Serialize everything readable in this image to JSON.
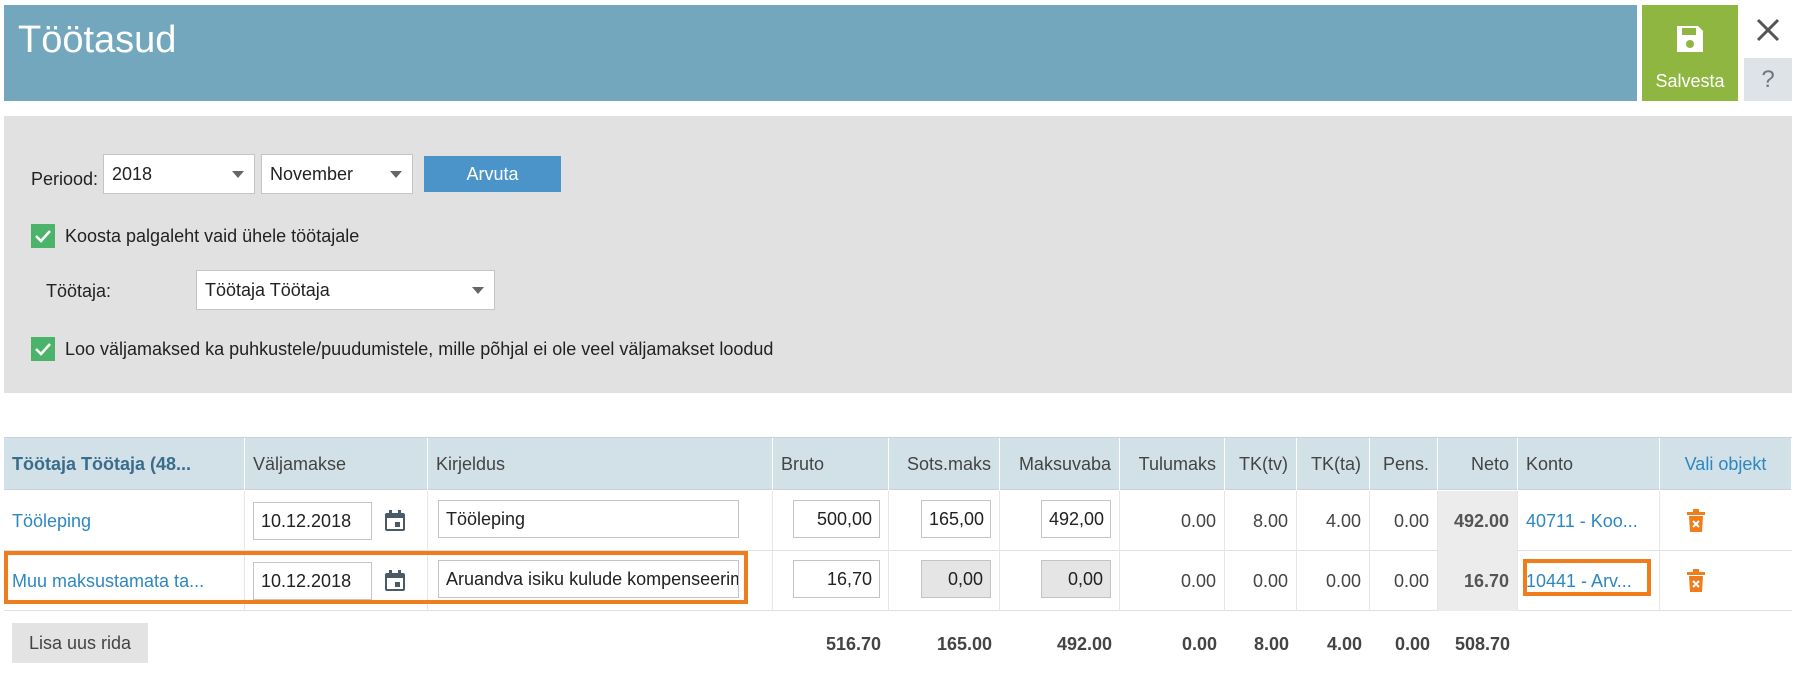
{
  "header": {
    "title": "Töötasud",
    "save_label": "Salvesta",
    "help_label": "?"
  },
  "filters": {
    "period_label": "Periood:",
    "year": "2018",
    "month": "November",
    "compute_label": "Arvuta",
    "single_employee_label": "Koosta palgaleht vaid ühele töötajale",
    "single_employee_checked": true,
    "employee_label": "Töötaja:",
    "employee_value": "Töötaja Töötaja",
    "absences_label": "Loo väljamaksed ka puhkustele/puudumistele, mille põhjal ei ole veel väljamakset loodud",
    "absences_checked": true
  },
  "table": {
    "headers": {
      "employee": "Töötaja Töötaja (48...",
      "payment": "Väljamakse",
      "description": "Kirjeldus",
      "gross": "Bruto",
      "social": "Sots.maks",
      "taxfree": "Maksuvaba",
      "income_tax": "Tulumaks",
      "tk_tv": "TK(tv)",
      "tk_ta": "TK(ta)",
      "pens": "Pens.",
      "net": "Neto",
      "account": "Konto",
      "object": "Vali objekt"
    },
    "rows": [
      {
        "type": "Tööleping",
        "date": "10.12.2018",
        "description": "Tööleping",
        "gross": "500,00",
        "social": "165,00",
        "taxfree": "492,00",
        "income_tax": "0.00",
        "tk_tv": "8.00",
        "tk_ta": "4.00",
        "pens": "0.00",
        "net": "492.00",
        "account": "40711 - Koo..."
      },
      {
        "type": "Muu maksustamata ta...",
        "date": "10.12.2018",
        "description": "Aruandva isiku kulude kompenseerimine",
        "gross": "16,70",
        "social": "0,00",
        "taxfree": "0,00",
        "income_tax": "0.00",
        "tk_tv": "0.00",
        "tk_ta": "0.00",
        "pens": "0.00",
        "net": "16.70",
        "account": "10441 - Arv..."
      }
    ],
    "totals": {
      "gross": "516.70",
      "social": "165.00",
      "taxfree": "492.00",
      "income_tax": "0.00",
      "tk_tv": "8.00",
      "tk_ta": "4.00",
      "pens": "0.00",
      "net": "508.70"
    },
    "add_row_label": "Lisa uus rida"
  },
  "colors": {
    "header_bg": "#72a7bd",
    "save_bg": "#8fb640",
    "accent_blue": "#4a94ca",
    "check_green": "#4cb36a",
    "highlight_orange": "#f07d1c",
    "trash_orange": "#f07d1c"
  },
  "icons": [
    "floppy-disk-icon",
    "close-icon",
    "calendar-icon",
    "trash-icon",
    "checkmark-icon",
    "chevron-down-icon"
  ]
}
